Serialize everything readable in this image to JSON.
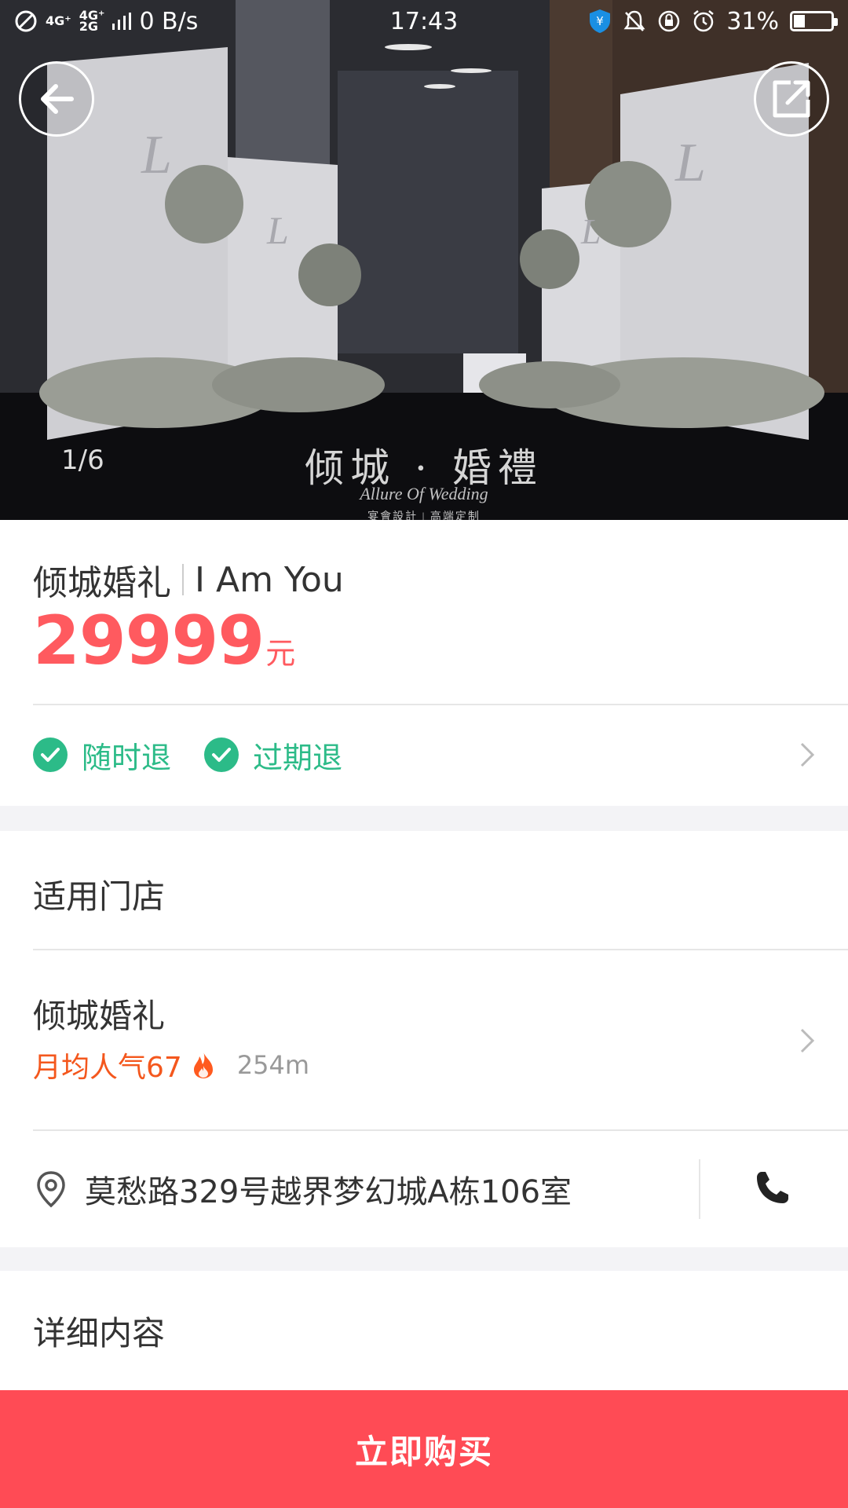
{
  "status_bar": {
    "network_left": "4G⁺",
    "network_right": "4G⁺",
    "network_sub": "2G",
    "speed": "0 B/s",
    "time": "17:43",
    "battery": "31%",
    "battery_level": 0.31
  },
  "hero": {
    "counter": "1/6",
    "watermark_title": "倾城 · 婚禮",
    "watermark_sub": "Allure Of Wedding",
    "watermark_tagline": "宴會設計 | 高端定制"
  },
  "product": {
    "shop": "倾城婚礼",
    "package": "I Am You",
    "price": "29999",
    "price_unit": "元"
  },
  "tags": [
    {
      "label": "随时退"
    },
    {
      "label": "过期退"
    }
  ],
  "store": {
    "section_title": "适用门店",
    "name": "倾城婚礼",
    "popularity": "月均人气67",
    "distance": "254m",
    "address": "莫愁路329号越界梦幻城A栋106室"
  },
  "detail": {
    "section_title": "详细内容"
  },
  "buy_button": "立即购买",
  "colors": {
    "price": "#ff5a5f",
    "tag_green": "#2cbb88",
    "popularity": "#f4571d",
    "buy_bar": "#ff4b55"
  }
}
